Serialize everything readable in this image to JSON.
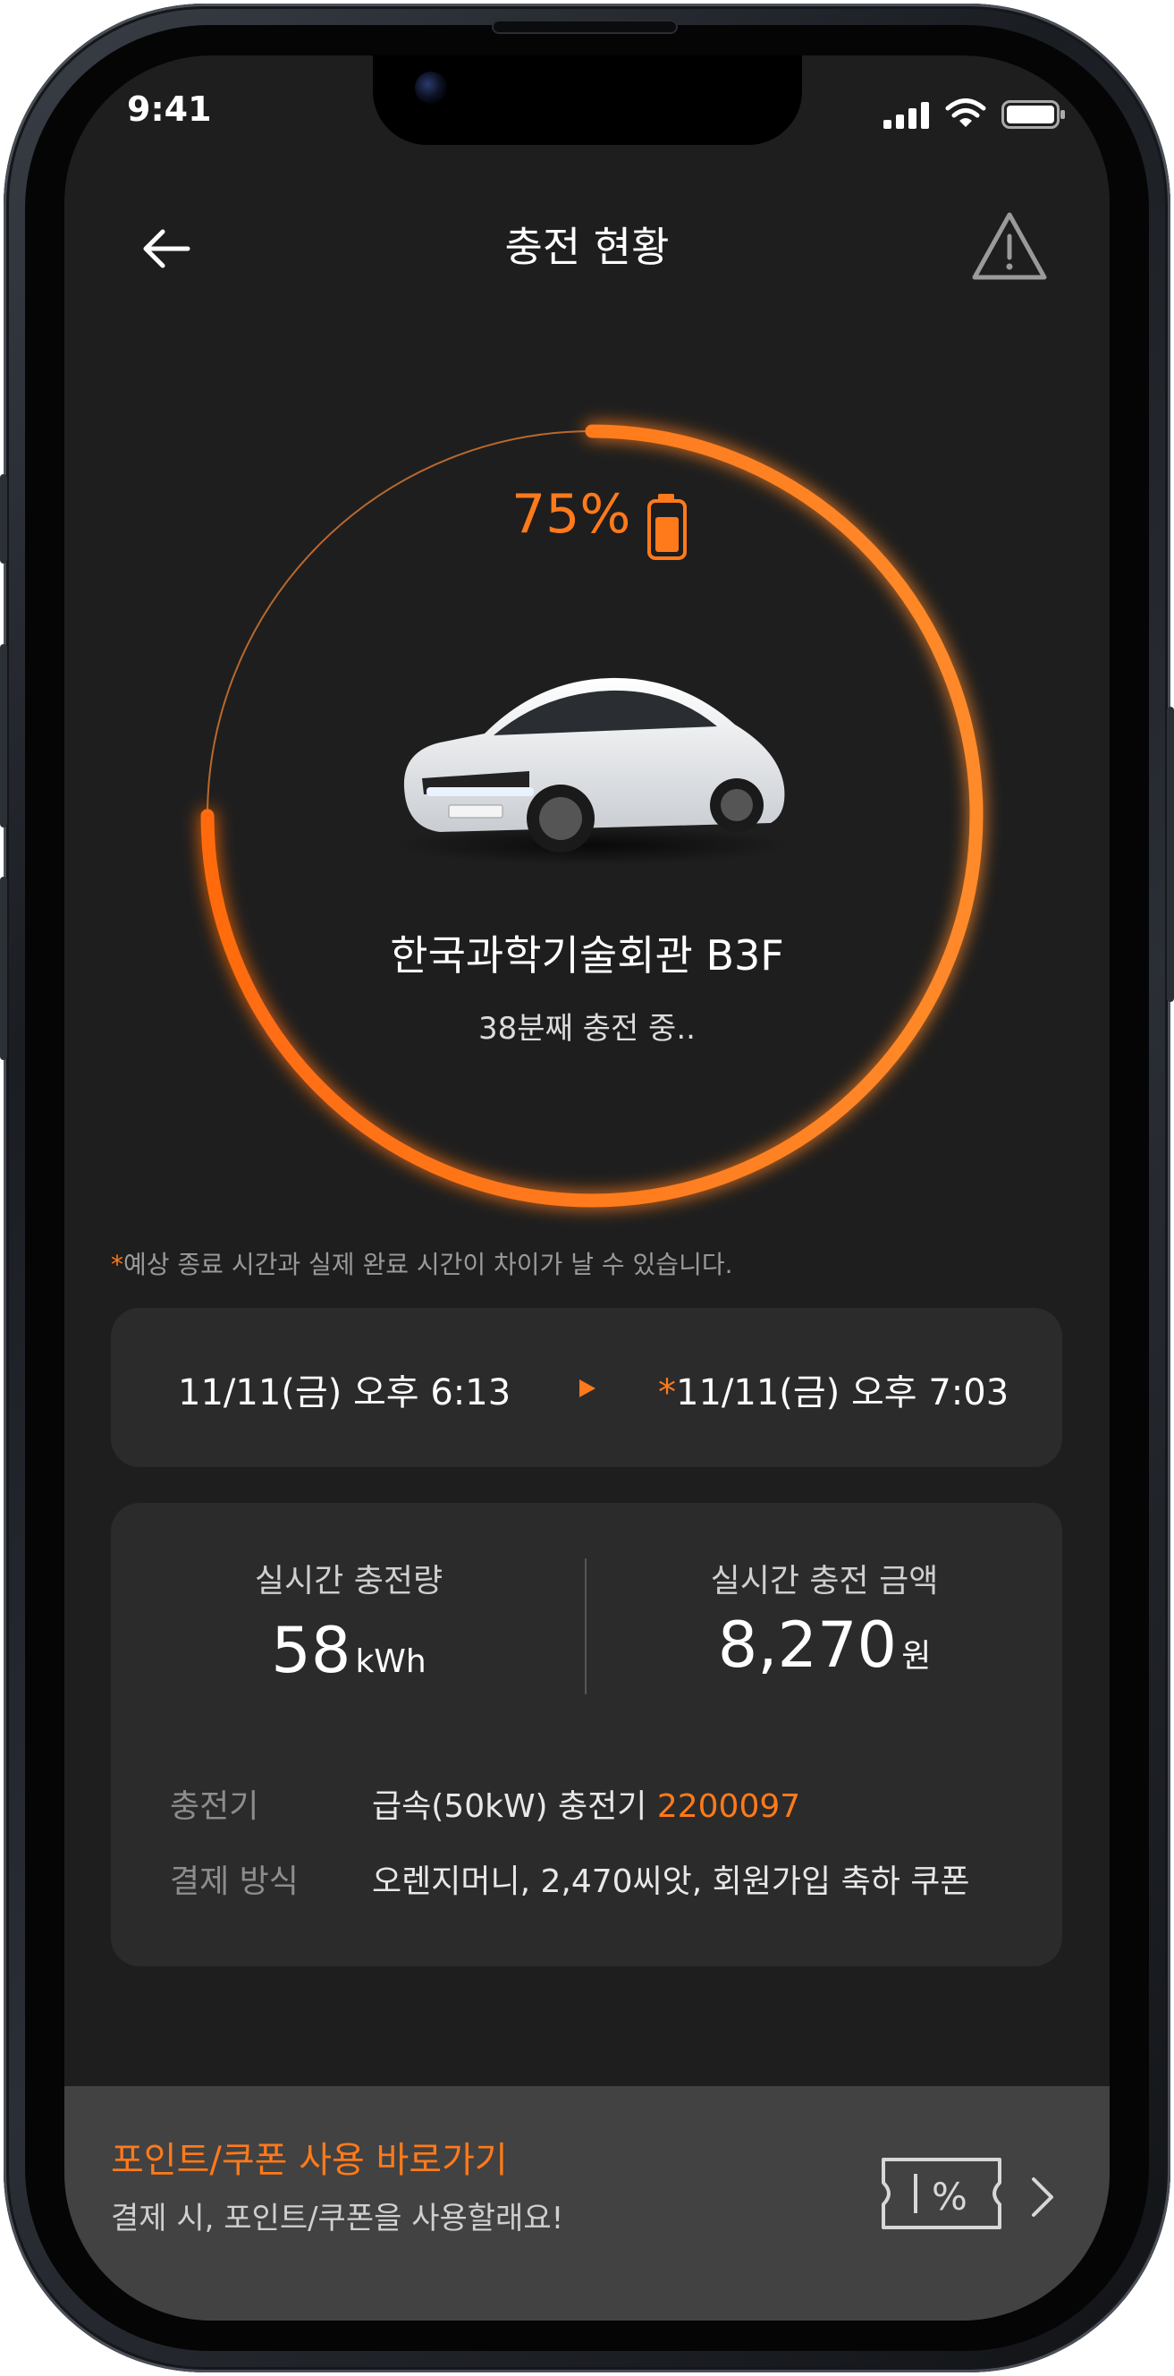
{
  "status_bar": {
    "time": "9:41"
  },
  "header": {
    "title": "충전 현황",
    "back_icon": "arrow-left-icon",
    "alert_icon": "warning-triangle-icon"
  },
  "charge": {
    "percent_text": "75%",
    "progress": 0.75,
    "location": "한국과학기술회관 B3F",
    "elapsed": "38분째 충전 중..",
    "accent_color": "#ff7a1a"
  },
  "notice": {
    "asterisk": "*",
    "text": "예상 종료 시간과 실제 완료 시간이 차이가 날 수 있습니다."
  },
  "time_range": {
    "start": "11/11(금) 오후 6:13",
    "end_asterisk": "*",
    "end": "11/11(금) 오후 7:03"
  },
  "stats": {
    "energy_label": "실시간 충전량",
    "energy_value": "58",
    "energy_unit": "kWh",
    "amount_label": "실시간 충전 금액",
    "amount_value": "8,270",
    "amount_unit": "원"
  },
  "details": {
    "charger_label": "충전기",
    "charger_value": "급속(50kW) 충전기",
    "charger_id": "2200097",
    "payment_label": "결제 방식",
    "payment_value": "오렌지머니, 2,470씨앗, 회원가입 축하 쿠폰"
  },
  "banner": {
    "title": "포인트/쿠폰 사용 바로가기",
    "subtitle": "결제 시, 포인트/쿠폰을 사용할래요!"
  }
}
